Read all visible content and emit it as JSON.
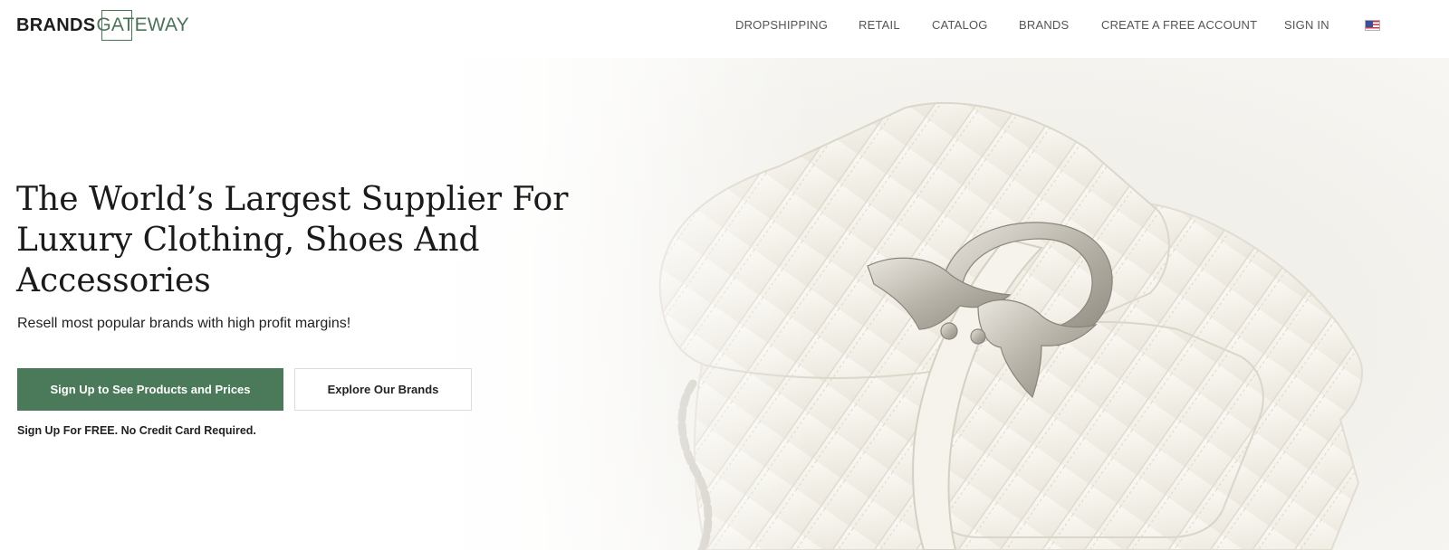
{
  "header": {
    "logo": {
      "bold": "BRANDS",
      "light": "GATEWAY"
    },
    "nav": [
      {
        "label": "DROPSHIPPING"
      },
      {
        "label": "RETAIL"
      },
      {
        "label": "CATALOG"
      },
      {
        "label": "BRANDS"
      },
      {
        "label": "CREATE A FREE ACCOUNT"
      },
      {
        "label": "SIGN IN"
      }
    ],
    "language_flag": "us-flag-icon"
  },
  "hero": {
    "headline": "The World’s Largest Supplier For Luxury Clothing, Shoes And Accessories",
    "subheadline": "Resell most popular brands with high profit margins!",
    "primary_button": "Sign Up to See Products and Prices",
    "secondary_button": "Explore Our Brands",
    "note": "Sign Up For FREE. No Credit Card Required.",
    "image": "white quilted leather handbag with silver bird buckle"
  },
  "colors": {
    "brand_green": "#4b7a5a",
    "nav_text": "#555555",
    "headline_text": "#1a1a1a"
  }
}
